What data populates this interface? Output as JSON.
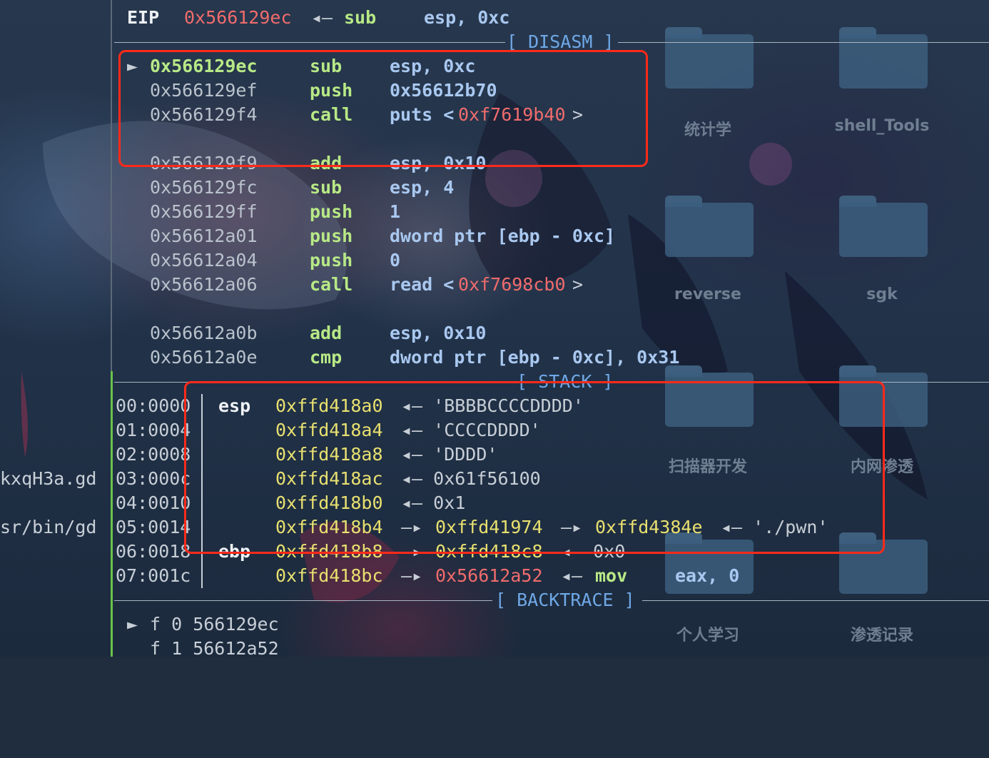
{
  "eip_line": {
    "label": "EIP",
    "addr": "0x566129ec",
    "arrow": "◂—",
    "mnemonic": "sub",
    "operands": "esp, 0xc"
  },
  "sections": {
    "disasm": "DISASM",
    "stack": "STACK",
    "backtrace": "BACKTRACE"
  },
  "current_marker": "►",
  "disasm": [
    {
      "addr": "0x566129ec",
      "mnemonic": "sub",
      "ops": "esp, 0xc",
      "sym": ""
    },
    {
      "addr": "0x566129ef",
      "mnemonic": "push",
      "ops": "0x56612b70",
      "sym": ""
    },
    {
      "addr": "0x566129f4",
      "mnemonic": "call",
      "ops": "puts <",
      "sym": "0xf7619b40",
      "tail": ">"
    },
    {
      "addr": "0x566129f9",
      "mnemonic": "add",
      "ops": "esp, 0x10",
      "sym": ""
    },
    {
      "addr": "0x566129fc",
      "mnemonic": "sub",
      "ops": "esp, 4",
      "sym": ""
    },
    {
      "addr": "0x566129ff",
      "mnemonic": "push",
      "ops": "1",
      "sym": ""
    },
    {
      "addr": "0x56612a01",
      "mnemonic": "push",
      "ops": "dword ptr [ebp - 0xc]",
      "sym": ""
    },
    {
      "addr": "0x56612a04",
      "mnemonic": "push",
      "ops": "0",
      "sym": ""
    },
    {
      "addr": "0x56612a06",
      "mnemonic": "call",
      "ops": "read <",
      "sym": "0xf7698cb0",
      "tail": ">"
    },
    {
      "addr": "0x56612a0b",
      "mnemonic": "add",
      "ops": "esp, 0x10",
      "sym": ""
    },
    {
      "addr": "0x56612a0e",
      "mnemonic": "cmp",
      "ops": "dword ptr [ebp - 0xc], 0x31",
      "sym": ""
    }
  ],
  "stack": [
    {
      "off": "00:0000",
      "reg": "esp",
      "addr": "0xffd418a0",
      "rest": "◂— 'BBBBCCCCDDDD'"
    },
    {
      "off": "01:0004",
      "reg": "",
      "addr": "0xffd418a4",
      "rest": "◂— 'CCCCDDDD'"
    },
    {
      "off": "02:0008",
      "reg": "",
      "addr": "0xffd418a8",
      "rest": "◂— 'DDDD'"
    },
    {
      "off": "03:000c",
      "reg": "",
      "addr": "0xffd418ac",
      "rest": "◂— 0x61f56100"
    },
    {
      "off": "04:0010",
      "reg": "",
      "addr": "0xffd418b0",
      "rest": "◂— 0x1"
    },
    {
      "off": "05:0014",
      "reg": "",
      "addr": "0xffd418b4",
      "a1": "—▸",
      "p1": "0xffd41974",
      "a2": "—▸",
      "p2": "0xffd4384e",
      "rest2": "◂— './pwn'"
    },
    {
      "off": "06:0018",
      "reg": "ebp",
      "addr": "0xffd418b8",
      "a1": "—▸",
      "p1": "0xffd418c8",
      "rest2": "◂— 0x0"
    },
    {
      "off": "07:001c",
      "reg": "",
      "addr": "0xffd418bc",
      "a1": "—▸",
      "p1": "0x56612a52",
      "rest2": "◂—",
      "mn": "mov",
      "ops": "eax, 0"
    }
  ],
  "backtrace": [
    {
      "marker": "►",
      "text": "f 0 566129ec"
    },
    {
      "marker": "",
      "text": "f 1 56612a52"
    }
  ],
  "left_fragments": [
    "kxqH3a.gd",
    "sr/bin/gd"
  ],
  "desktop_folders": [
    {
      "label": "统计学"
    },
    {
      "label": "shell_Tools"
    },
    {
      "label": "reverse"
    },
    {
      "label": "sgk"
    },
    {
      "label": "扫描器开发"
    },
    {
      "label": "内网渗透"
    },
    {
      "label": "个人学习"
    },
    {
      "label": "渗透记录"
    }
  ],
  "colors": {
    "highlight_box": "#ff2a1a",
    "mnemonic": "#b8e986",
    "symbol": "#f06c6c",
    "pointer": "#e8e070"
  }
}
